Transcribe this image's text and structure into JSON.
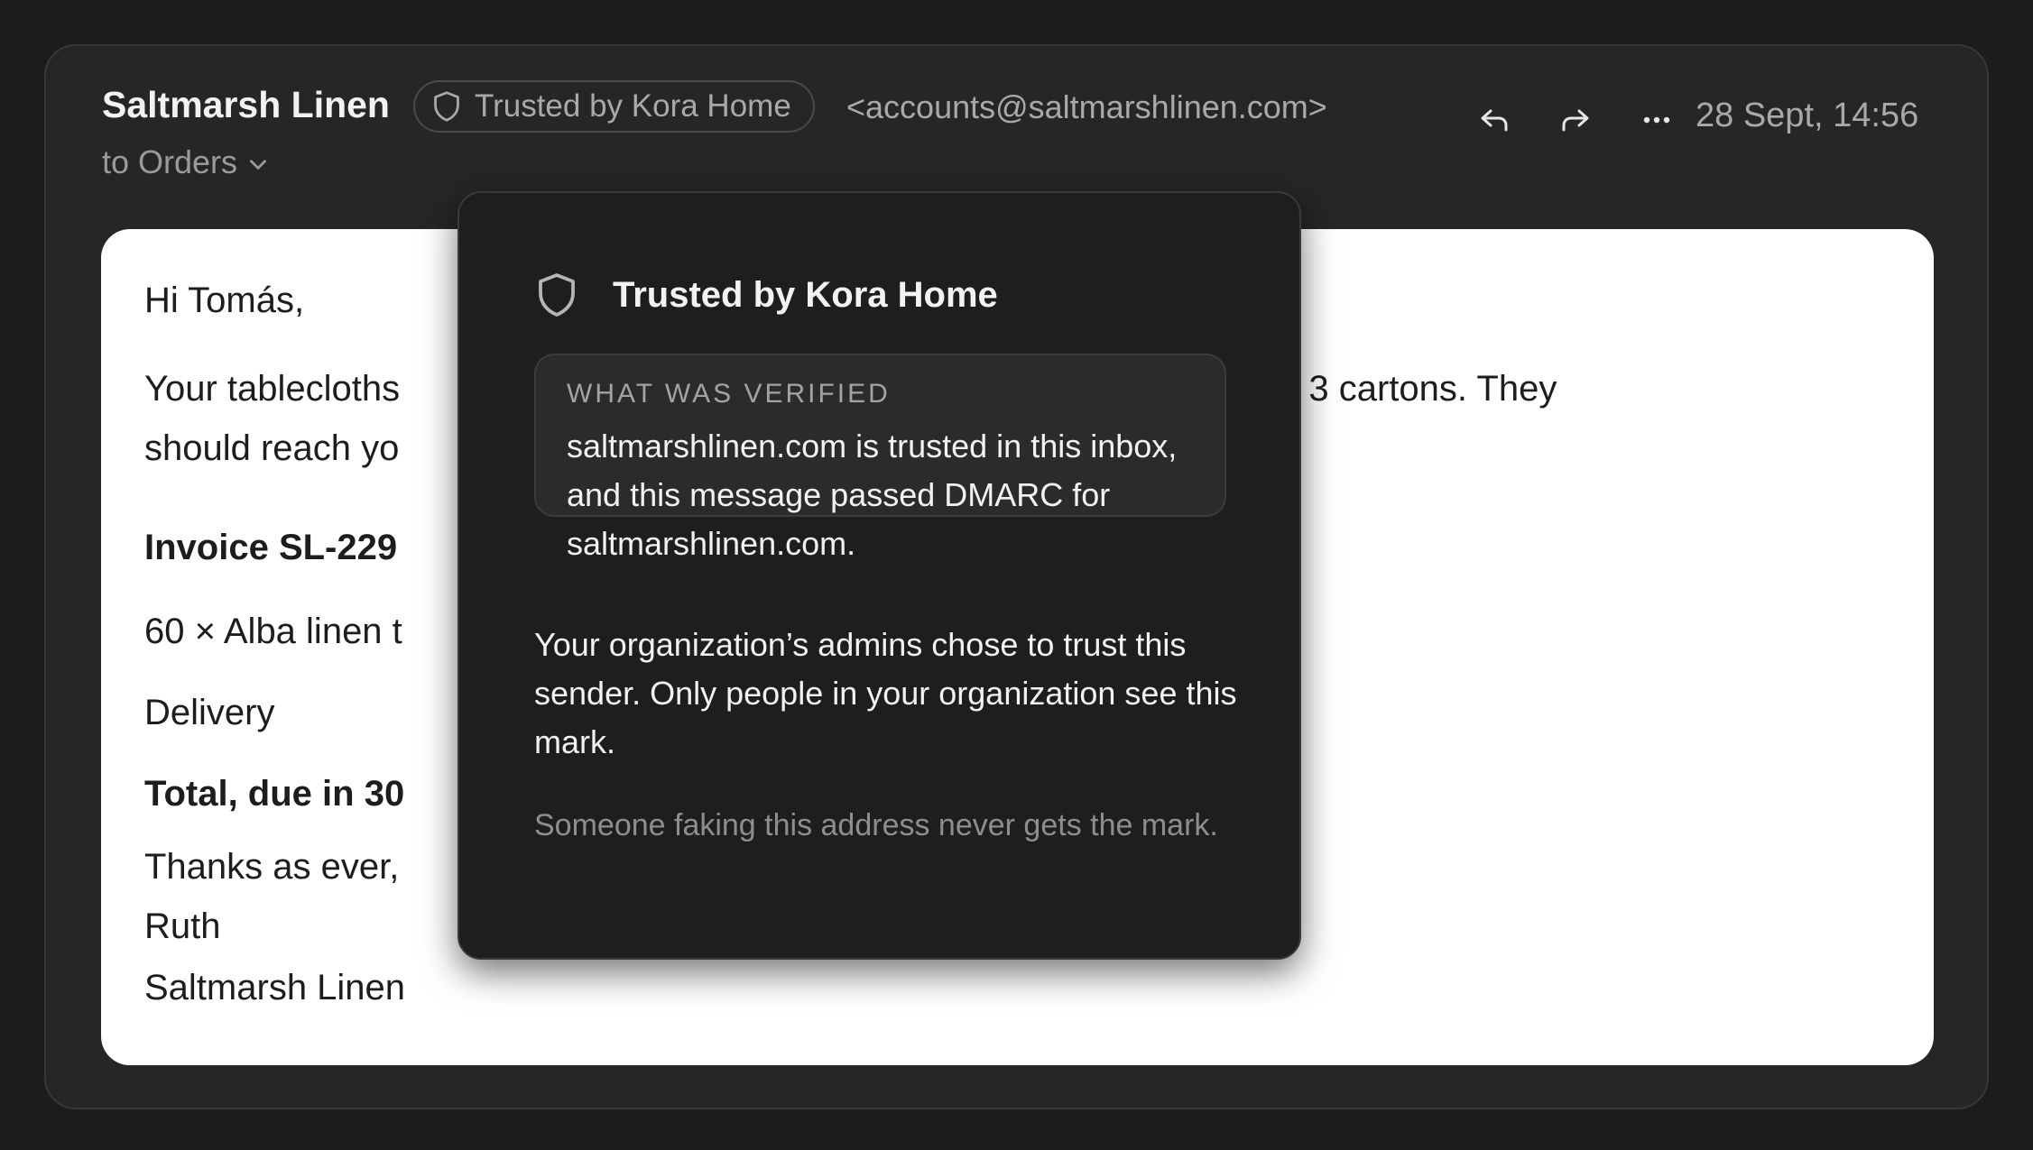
{
  "header": {
    "sender_name": "Saltmarsh Linen",
    "trust_badge_label": "Trusted by Kora Home",
    "sender_email": "<accounts@saltmarshlinen.com>",
    "recipient_label": "to Orders",
    "timestamp": "28 Sept, 14:56",
    "actions": [
      {
        "name": "reply",
        "icon": "reply-icon"
      },
      {
        "name": "forward",
        "icon": "forward-icon"
      },
      {
        "name": "more",
        "icon": "more-horizontal-icon"
      }
    ]
  },
  "message": {
    "greeting": "Hi Tomás,",
    "paragraph_line1_left": "Your tablecloths",
    "paragraph_line1_right": "n 3 cartons. They",
    "paragraph_line2": "should reach yo",
    "invoice_heading": "Invoice SL-229",
    "line_item": "60 × Alba linen t",
    "delivery_label": "Delivery",
    "total_label": "Total, due in 30",
    "signoff": "Thanks as ever,",
    "signature_name": "Ruth",
    "signature_company": "Saltmarsh Linen"
  },
  "popover": {
    "title": "Trusted by Kora Home",
    "verified_heading": "WHAT WAS VERIFIED",
    "verified_body": "saltmarshlinen.com is trusted in this inbox, and this message passed DMARC for saltmarshlinen.com.",
    "body": "Your organization’s admins chose to trust this sender. Only people in your organization see this mark.",
    "footnote": "Someone faking this address never gets the mark."
  },
  "colors": {
    "background": "#1c1c1c",
    "window": "#262626",
    "popover": "#1e1e1e",
    "message_card": "#ffffff",
    "muted_text": "#a9a9a9"
  }
}
